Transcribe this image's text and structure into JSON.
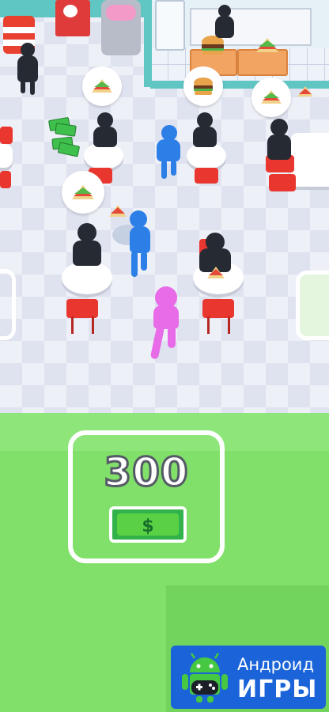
{
  "unlock_zone": {
    "price": "300",
    "currency_icon": "dollar-bill-icon",
    "currency_symbol": "$"
  },
  "watermark": {
    "line1": "Андроид",
    "line2": "ИГРЫ",
    "icon": "android-robot-gamepad-icon"
  },
  "orders": [
    "sandwich",
    "burger",
    "sandwich",
    "sandwich"
  ],
  "colors": {
    "player": "#e86be8",
    "waiter": "#2d7fe8",
    "customer": "#262a33",
    "chair": "#e9362f",
    "grass": "#80e06a",
    "bill": "#31b24a"
  }
}
